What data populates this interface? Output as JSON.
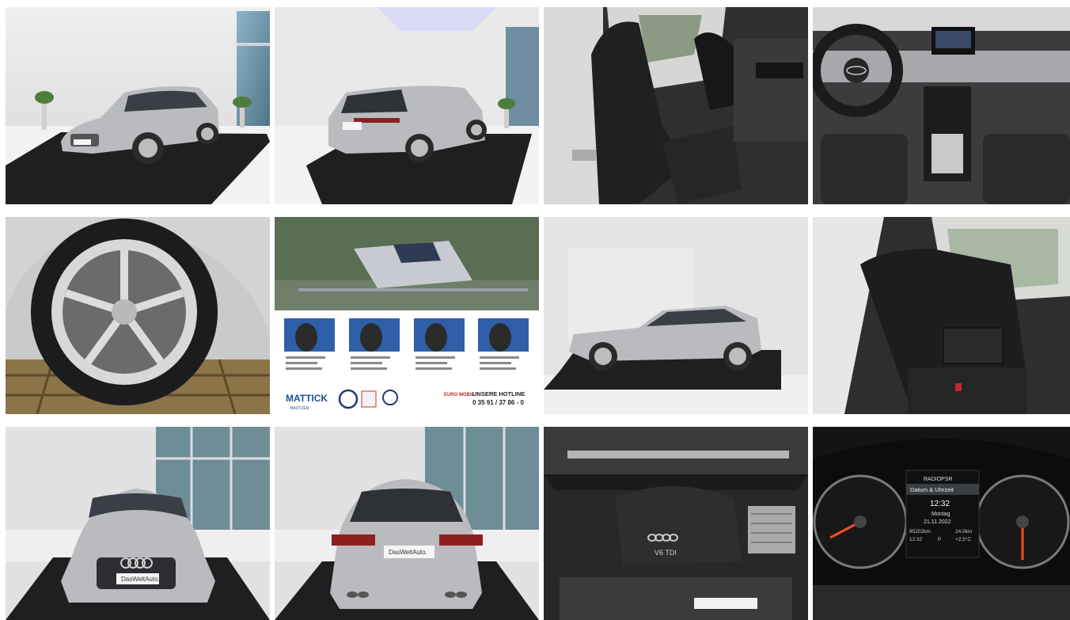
{
  "gallery": {
    "photos": [
      {
        "subject": "Front three-quarter view in showroom",
        "plate": "DasWeltAuto."
      },
      {
        "subject": "Rear three-quarter view in showroom",
        "plate": "DasWeltAuto."
      },
      {
        "subject": "Front seats interior"
      },
      {
        "subject": "Dashboard and steering wheel"
      },
      {
        "subject": "Alloy wheel close-up"
      },
      {
        "subject": "Dealership brochure"
      },
      {
        "subject": "Side profile"
      },
      {
        "subject": "Rear seats interior"
      },
      {
        "subject": "Front view",
        "plate": "DasWeltAuto."
      },
      {
        "subject": "Rear view",
        "plate": "DasWeltAuto."
      },
      {
        "subject": "Engine bay",
        "engine_badge": "V6 TDI"
      },
      {
        "subject": "Instrument cluster"
      }
    ],
    "brochure": {
      "dealer_logo": "MATTICK",
      "dealer_city": "BAUTZEN",
      "hotline_label": "UNSERE HOTLINE",
      "hotline_number": "0 35 91 / 37 86 - 0",
      "euro_badge": "EURO MOBIL"
    },
    "cluster": {
      "radio": "RADIOPSR",
      "menu": "Datum & Uhrzeit",
      "time": "12:32",
      "day": "Montag",
      "date": "21.11.2022",
      "odometer": "85202km",
      "range": "24,0km",
      "temp": "+2,5°C",
      "clock_small": "12:32",
      "gear": "P"
    },
    "colors": {
      "car_silver": "#b9bbbe",
      "floor": "#1f1f22",
      "wall": "#e6e6e6"
    }
  }
}
